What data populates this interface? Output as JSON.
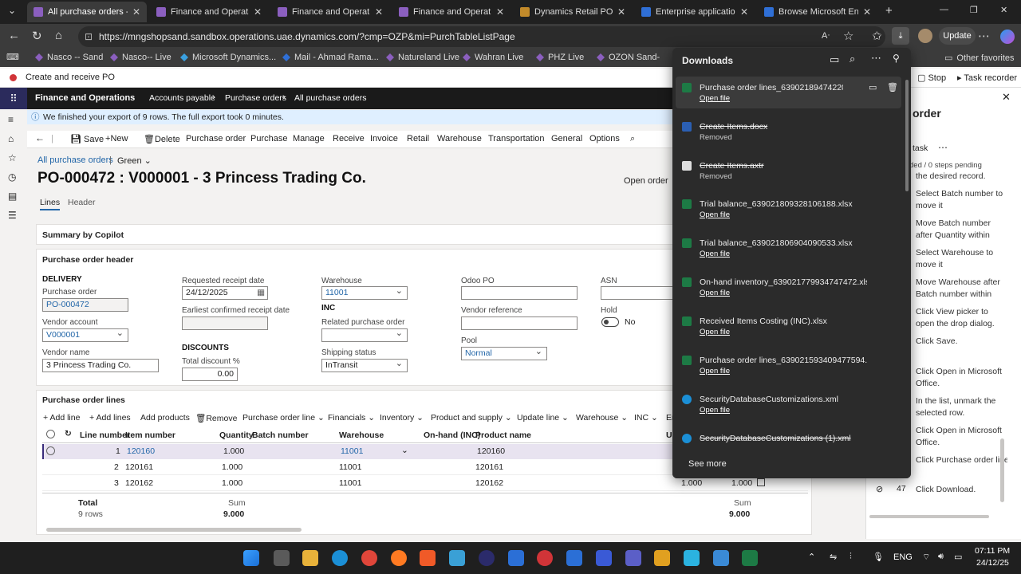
{
  "browser": {
    "tabs": [
      {
        "label": "All purchase orders -- F",
        "color": "#8b5fbf",
        "active": true
      },
      {
        "label": "Finance and Operation",
        "color": "#8b5fbf"
      },
      {
        "label": "Finance and Operation",
        "color": "#8b5fbf"
      },
      {
        "label": "Finance and Operation",
        "color": "#8b5fbf"
      },
      {
        "label": "Dynamics Retail POS",
        "color": "#c28a2a"
      },
      {
        "label": "Enterprise applications",
        "color": "#2f6fd6"
      },
      {
        "label": "Browse Microsoft Entra",
        "color": "#2f6fd6"
      }
    ],
    "new_tab": "+",
    "url": "https://mngshopsand.sandbox.operations.uae.dynamics.com/?cmp=OZP&mi=PurchTableListPage",
    "update_label": "Update",
    "favorites": [
      "Nasco -- Sand",
      "Nasco-- Live",
      "Microsoft Dynamics...",
      "Mail - Ahmad Rama...",
      "Natureland Live",
      "Wahran Live",
      "PHZ Live",
      "OZON Sand-",
      "Other favorites"
    ]
  },
  "d365": {
    "task_label": "Create and receive PO",
    "stop_label": "Stop",
    "task_recorder_label": "Task recorder",
    "app_name": "Finance and Operations",
    "breadcrumb": [
      "Accounts payable",
      "Purchase orders",
      "All purchase orders"
    ],
    "message": "We finished your export of 9 rows. The full export took 0 minutes.",
    "actions": [
      "Save",
      "New",
      "Delete",
      "Purchase order",
      "Purchase",
      "Manage",
      "Receive",
      "Invoice",
      "Retail",
      "Warehouse",
      "Transportation",
      "General",
      "Options"
    ],
    "view_link": "All purchase orders",
    "view_sep": "|",
    "view_name": "Green",
    "title": "PO-000472 : V000001 - 3 Princess Trading Co.",
    "status": "Open order",
    "tabs": [
      "Lines",
      "Header"
    ],
    "summary_title": "Summary by Copilot",
    "header_title": "Purchase order header",
    "delivery_section": "DELIVERY",
    "purchase_order_label": "Purchase order",
    "purchase_order_value": "PO-000472",
    "vendor_account_label": "Vendor account",
    "vendor_account_value": "V000001",
    "vendor_name_label": "Vendor name",
    "vendor_name_value": "3 Princess Trading Co.",
    "req_receipt_label": "Requested receipt date",
    "req_receipt_value": "24/12/2025",
    "earliest_label": "Earliest confirmed receipt date",
    "discounts_section": "DISCOUNTS",
    "total_discount_label": "Total discount %",
    "total_discount_value": "0.00",
    "warehouse_label": "Warehouse",
    "warehouse_value": "11001",
    "inc_section": "INC",
    "related_po_label": "Related purchase order",
    "shipping_label": "Shipping status",
    "shipping_value": "InTransit",
    "odoo_label": "Odoo PO",
    "vendor_ref_label": "Vendor reference",
    "pool_label": "Pool",
    "pool_value": "Normal",
    "asn_label": "ASN",
    "hold_label": "Hold",
    "hold_value": "No",
    "lines_title": "Purchase order lines",
    "line_actions": [
      "Add line",
      "Add lines",
      "Add products",
      "Remove",
      "Purchase order line",
      "Financials",
      "Inventory",
      "Product and supply",
      "Update line",
      "Warehouse",
      "INC",
      "Er"
    ],
    "columns": [
      "Line number",
      "Item number",
      "Quantity",
      "Batch number",
      "Warehouse",
      "On-hand (INC)",
      "Product name",
      "U"
    ],
    "rows": [
      {
        "line": "1",
        "item": "120160",
        "qty": "1.000",
        "wh": "11001",
        "product": "120160",
        "q2": "",
        "q3": ""
      },
      {
        "line": "2",
        "item": "120161",
        "qty": "1.000",
        "wh": "11001",
        "product": "120161",
        "q2": "",
        "q3": ""
      },
      {
        "line": "3",
        "item": "120162",
        "qty": "1.000",
        "wh": "11001",
        "product": "120162",
        "q2": "1.000",
        "q3": "1.000"
      }
    ],
    "total_label": "Total",
    "total_rows": "9 rows",
    "sum_label": "Sum",
    "sum_value": "9.000",
    "sum2_label": "Sum",
    "sum2_value": "9.000"
  },
  "downloads": {
    "title": "Downloads",
    "see_more": "See more",
    "items": [
      {
        "name": "Purchase order lines_639021894742202540.xlsx",
        "sub": "Open file",
        "link": true,
        "strike": false,
        "color": "#1d7a45"
      },
      {
        "name": "Create Items.docx",
        "sub": "Removed",
        "link": false,
        "strike": true,
        "color": "#2b5fb3"
      },
      {
        "name": "Create Items.axtr",
        "sub": "Removed",
        "link": false,
        "strike": true,
        "color": "#dddddd"
      },
      {
        "name": "Trial balance_639021809328106188.xlsx",
        "sub": "Open file",
        "link": true,
        "strike": false,
        "color": "#1d7a45"
      },
      {
        "name": "Trial balance_639021806904090533.xlsx",
        "sub": "Open file",
        "link": true,
        "strike": false,
        "color": "#1d7a45"
      },
      {
        "name": "On-hand inventory_639021779934747472.xlsx",
        "sub": "Open file",
        "link": true,
        "strike": false,
        "color": "#1d7a45"
      },
      {
        "name": "Received Items Costing (INC).xlsx",
        "sub": "Open file",
        "link": true,
        "strike": false,
        "color": "#1d7a45"
      },
      {
        "name": "Purchase order lines_639021593409477594.xlsx",
        "sub": "Open file",
        "link": true,
        "strike": false,
        "color": "#1d7a45"
      },
      {
        "name": "SecurityDatabaseCustomizations.xml",
        "sub": "Open file",
        "link": true,
        "strike": false,
        "color": "#1b8fd6"
      },
      {
        "name": "SecurityDatabaseCustomizations (1).xml",
        "sub": "",
        "link": false,
        "strike": true,
        "color": "#1b8fd6"
      }
    ]
  },
  "recorder": {
    "title": "order",
    "task_label": "task",
    "progress": "ded / 0 steps pending",
    "steps": [
      "the desired record.",
      "Select Batch number to move it",
      "Move Batch number after Quantity within LineSpec",
      "Select Warehouse to move it",
      "Move Warehouse after Batch number within",
      "Click View picker to open the drop dialog.",
      "Click Save.",
      "Click Open in Microsoft Office.",
      "In the list, unmark the selected row.",
      "Click Open in Microsoft Office.",
      "Click Purchase order line",
      "Click Download."
    ],
    "last_step_number": "47"
  },
  "taskbar": {
    "lang": "ENG",
    "time": "07:11 PM",
    "date": "24/12/25"
  }
}
